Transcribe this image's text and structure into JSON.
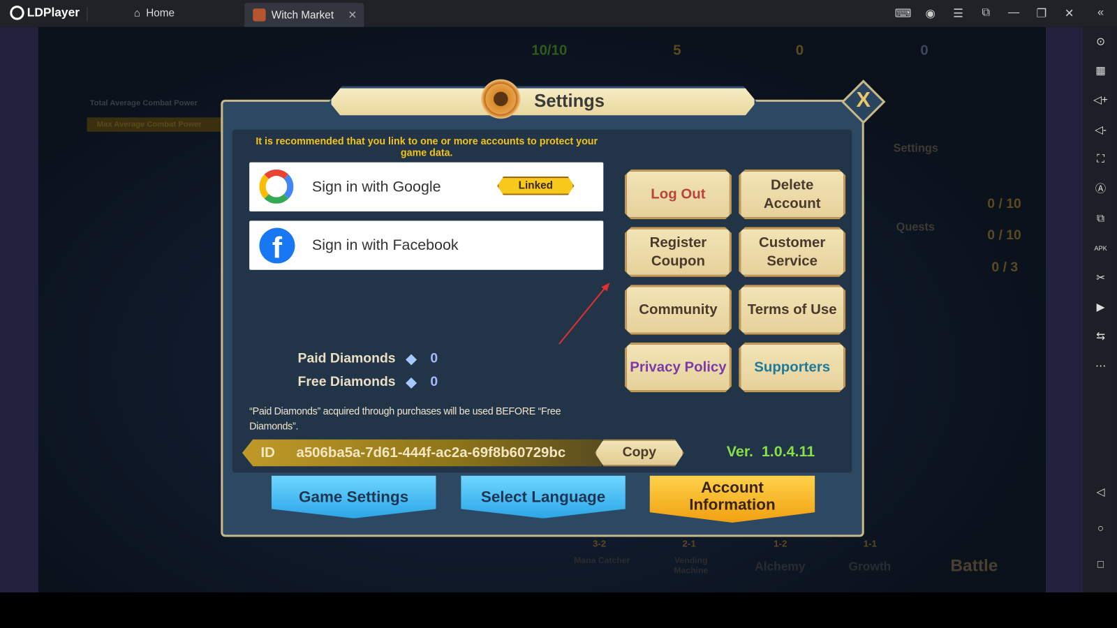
{
  "app": {
    "name": "LDPlayer",
    "tabs": [
      {
        "label": "Home"
      },
      {
        "label": "Witch Market",
        "active": true
      }
    ]
  },
  "game_background": {
    "resources": [
      "10/10",
      "5",
      "0",
      "0"
    ],
    "combat": [
      "Total Average Combat Power",
      "Max Average Combat Power"
    ],
    "menu": [
      "Settings",
      "Quests"
    ],
    "counters": [
      "0 / 10",
      "0 / 10",
      "0 / 3"
    ],
    "stages": [
      {
        "lock": "3-2",
        "label": "Mana Catcher"
      },
      {
        "lock": "2-1",
        "label": "Vending Machine"
      },
      {
        "lock": "1-2",
        "label": "Alchemy"
      },
      {
        "lock": "1-1",
        "label": "Growth"
      }
    ],
    "battle": "Battle"
  },
  "dialog": {
    "title": "Settings",
    "close": "X",
    "notice": "It is recommended that you link to one or more accounts to protect your game data.",
    "google": {
      "label": "Sign in with Google",
      "badge": "Linked"
    },
    "facebook": {
      "label": "Sign in with Facebook",
      "icon_letter": "f"
    },
    "buttons": [
      {
        "label": "Log Out",
        "color": "#b8453c"
      },
      {
        "label": "Delete Account",
        "color": "#4a3a2c"
      },
      {
        "label": "Register Coupon",
        "color": "#4a3a2c"
      },
      {
        "label": "Customer Service",
        "color": "#4a3a2c"
      },
      {
        "label": "Community",
        "color": "#4a3a2c"
      },
      {
        "label": "Terms of Use",
        "color": "#4a3a2c"
      },
      {
        "label": "Privacy Policy",
        "color": "#7a3aa8"
      },
      {
        "label": "Supporters",
        "color": "#1f7a9a"
      }
    ],
    "paid_diamonds": {
      "label": "Paid Diamonds",
      "value": "0"
    },
    "free_diamonds": {
      "label": "Free Diamonds",
      "value": "0"
    },
    "note": "“Paid Diamonds” acquired through purchases will be used BEFORE “Free Diamonds”.",
    "id_label": "ID",
    "id_value": "a506ba5a-7d61-444f-ac2a-69f8b60729bc",
    "copy": "Copy",
    "version_label": "Ver.",
    "version": "1.0.4.11",
    "tabs": [
      {
        "label": "Game Settings"
      },
      {
        "label": "Select Language"
      },
      {
        "label": "Account Information",
        "active": true
      }
    ]
  }
}
